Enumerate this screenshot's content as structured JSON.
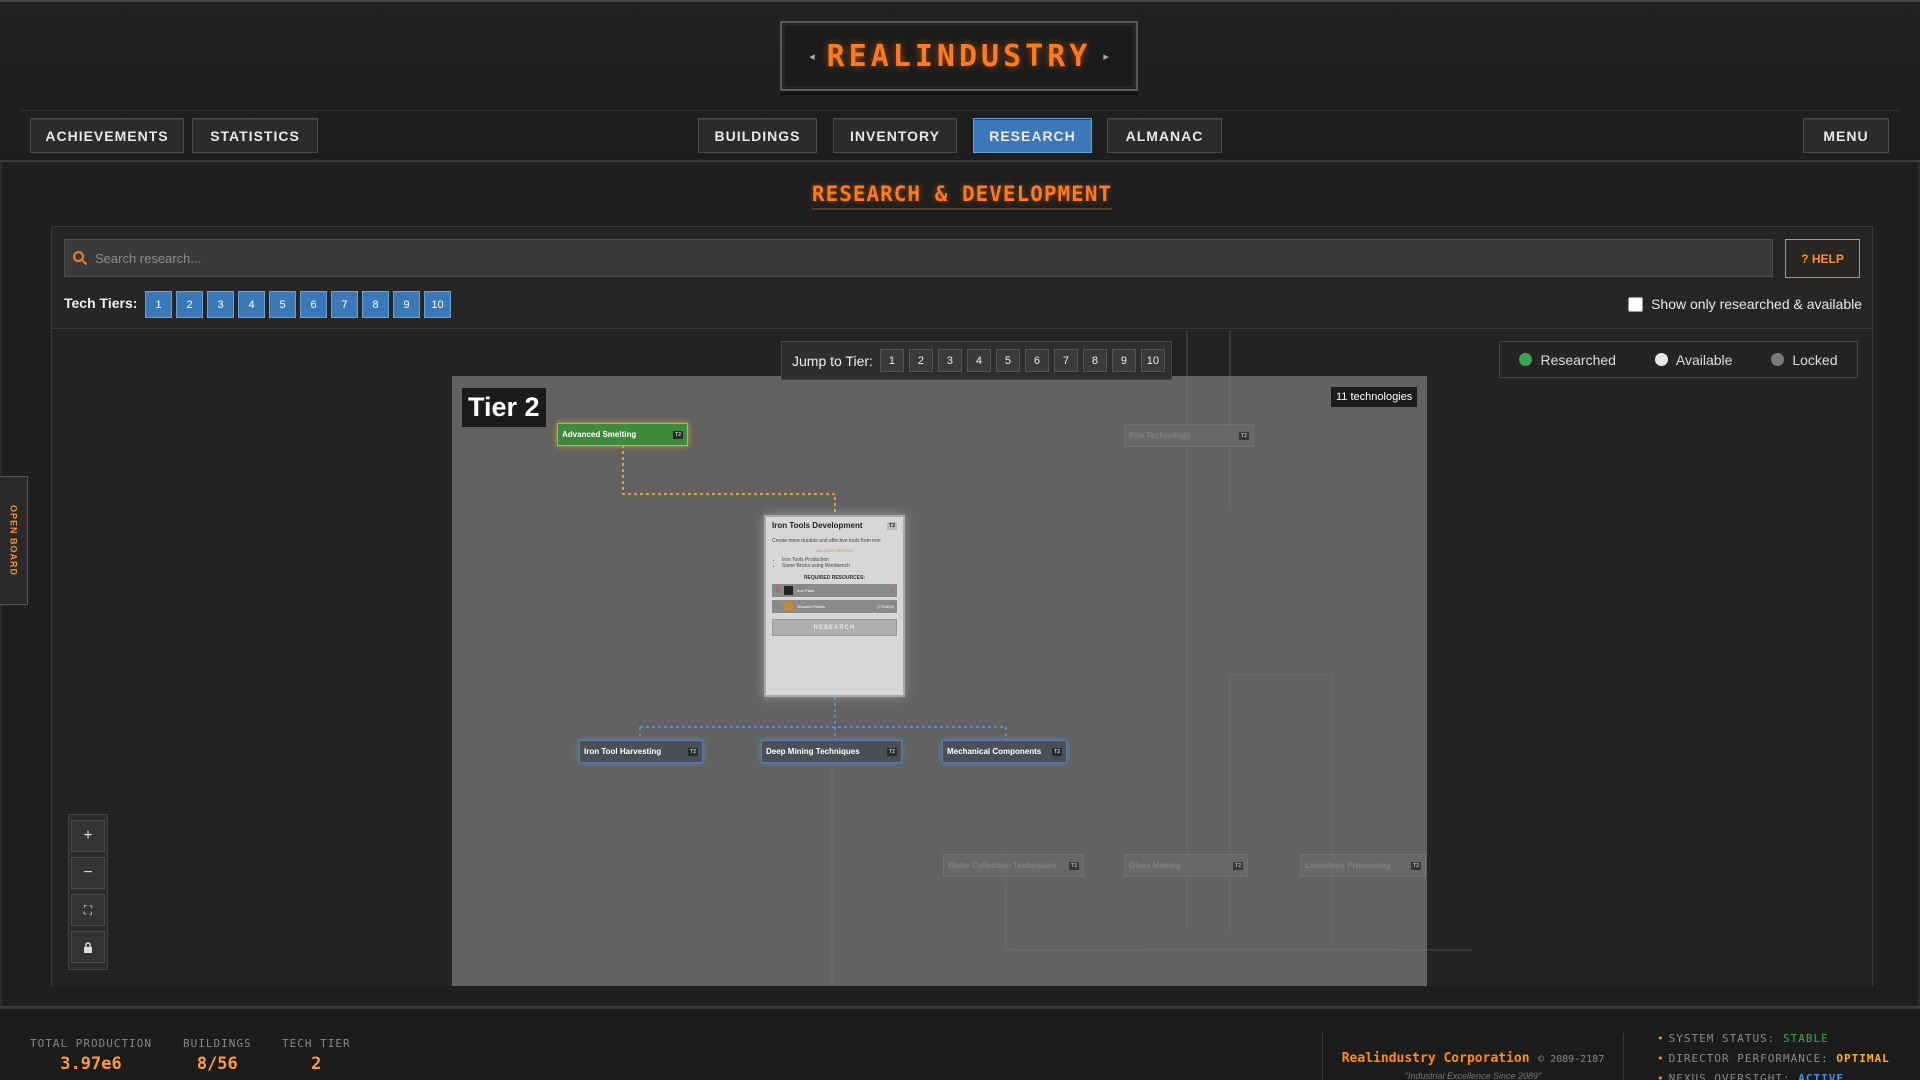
{
  "header": {
    "logo": "REALINDUSTRY",
    "nav_left": [
      "ACHIEVEMENTS",
      "STATISTICS"
    ],
    "nav_center": [
      "BUILDINGS",
      "INVENTORY",
      "RESEARCH",
      "ALMANAC"
    ],
    "nav_right": "MENU",
    "active_tab": "RESEARCH"
  },
  "page": {
    "title": "RESEARCH & DEVELOPMENT"
  },
  "toolbar": {
    "search_placeholder": "Search research...",
    "help_label": "? HELP",
    "tier_label": "Tech Tiers:",
    "tiers": [
      "1",
      "2",
      "3",
      "4",
      "5",
      "6",
      "7",
      "8",
      "9",
      "10"
    ],
    "filter_label": "Show only researched & available"
  },
  "canvas": {
    "jump_label": "Jump to Tier:",
    "jump_tiers": [
      "1",
      "2",
      "3",
      "4",
      "5",
      "6",
      "7",
      "8",
      "9",
      "10"
    ],
    "legend": [
      {
        "label": "Researched",
        "color": "#3aa84a"
      },
      {
        "label": "Available",
        "color": "#e8e8e8"
      },
      {
        "label": "Locked",
        "color": "#7a7a7a"
      }
    ],
    "tier_heading": "Tier 2",
    "tech_count": "11 technologies",
    "nodes": {
      "advanced_smelting": "Advanced Smelting",
      "kiln_technology": "Kiln Technology",
      "iron_tool_harvesting": "Iron Tool Harvesting",
      "deep_mining": "Deep Mining Techniques",
      "mechanical_components": "Mechanical Components",
      "water_collection": "Water Collection Techniques",
      "glass_making": "Glass Making",
      "limestone_processing": "Limestone Processing",
      "tier_tag": "T2"
    },
    "detail": {
      "title": "Iron Tools Development",
      "tag": "T2",
      "description": "Create more durable and effective tools from iron",
      "unlocks_label": "UNLOCKS RECIPES",
      "unlocks": [
        "Iron Tools Production",
        "Stone Bricks using Workbench"
      ],
      "required_label": "REQUIRED RESOURCES:",
      "resources": [
        {
          "name": "Iron Plate",
          "amount": "5"
        },
        {
          "name": "Wooden Planks",
          "amount": "(770/800)"
        }
      ],
      "research_label": "RESEARCH"
    },
    "side_tab": "OPEN BOARD"
  },
  "footer": {
    "production_label": "TOTAL PRODUCTION",
    "production_value": "3.97e6",
    "buildings_label": "BUILDINGS",
    "buildings_value": "8/56",
    "tier_label": "TECH TIER",
    "tier_value": "2",
    "corp_name": "Realindustry Corporation",
    "corp_years": "© 2089-2187",
    "corp_slogan": "\"Industrial Excellence Since 2089\"",
    "status": [
      {
        "label": "SYSTEM STATUS:",
        "value": "STABLE",
        "color": "#3aa84a"
      },
      {
        "label": "DIRECTOR PERFORMANCE:",
        "value": "OPTIMAL",
        "color": "#ffb020"
      },
      {
        "label": "NEXUS OVERSIGHT:",
        "value": "ACTIVE",
        "color": "#4a90e0"
      }
    ]
  }
}
